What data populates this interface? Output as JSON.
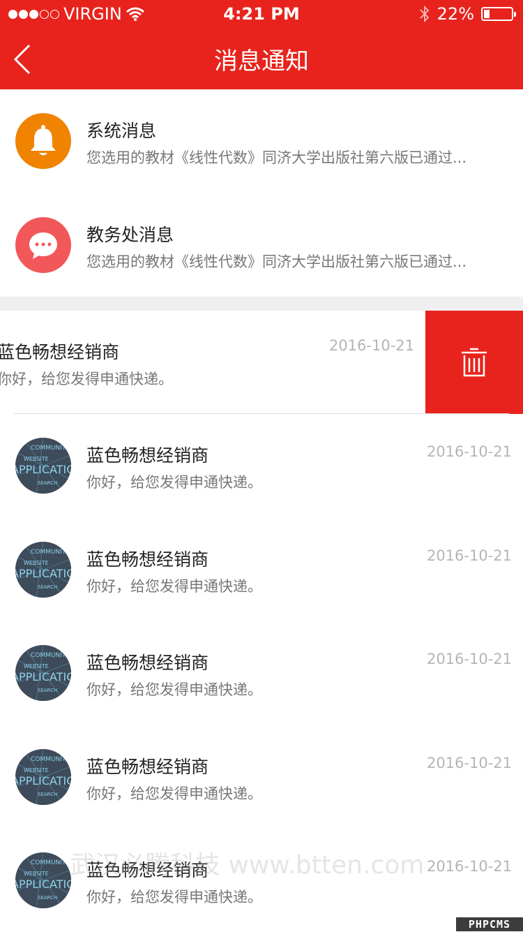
{
  "status_bar": {
    "carrier": "VIRGIN",
    "time": "4:21 PM",
    "battery_percent": "22%",
    "battery_level": 0.22,
    "signal_dots_filled": 3,
    "signal_dots_total": 5
  },
  "nav": {
    "title": "消息通知",
    "back_icon": "chevron-left-icon"
  },
  "notices": [
    {
      "title": "系统消息",
      "subtitle": "您选用的教材《线性代数》同济大学出版社第六版已通过...",
      "icon": "bell-icon",
      "color": "#f08300"
    },
    {
      "title": "教务处消息",
      "subtitle": "您选用的教材《线性代数》同济大学出版社第六版已通过...",
      "icon": "chat-bubble-icon",
      "color": "#f2575a"
    }
  ],
  "swiped_message": {
    "name": "蓝色畅想经销商",
    "preview": "你好，给您发得申通快递。",
    "date": "2016-10-21",
    "delete_icon": "trash-icon"
  },
  "messages": [
    {
      "name": "蓝色畅想经销商",
      "preview": "你好，给您发得申通快递。",
      "date": "2016-10-21",
      "avatar_text": [
        "COMMUNITY",
        "WEBSITE",
        "APPLICATION",
        "SEARCH"
      ]
    },
    {
      "name": "蓝色畅想经销商",
      "preview": "你好，给您发得申通快递。",
      "date": "2016-10-21",
      "avatar_text": [
        "COMMUNITY",
        "WEBSITE",
        "APPLICATION",
        "SEARCH"
      ]
    },
    {
      "name": "蓝色畅想经销商",
      "preview": "你好，给您发得申通快递。",
      "date": "2016-10-21",
      "avatar_text": [
        "COMMUNITY",
        "WEBSITE",
        "APPLICATION",
        "SEARCH"
      ]
    },
    {
      "name": "蓝色畅想经销商",
      "preview": "你好，给您发得申通快递。",
      "date": "2016-10-21",
      "avatar_text": [
        "COMMUNITY",
        "WEBSITE",
        "APPLICATION",
        "SEARCH"
      ]
    },
    {
      "name": "蓝色畅想经销商",
      "preview": "你好，给您发得申通快递。",
      "date": "2016-10-21",
      "avatar_text": [
        "COMMUNITY",
        "WEBSITE",
        "APPLICATION",
        "SEARCH"
      ]
    }
  ],
  "watermark": "武汉必腾科技 www.btten.com",
  "corner_badge": "PHPCMS",
  "colors": {
    "brand_red": "#e8231d"
  }
}
